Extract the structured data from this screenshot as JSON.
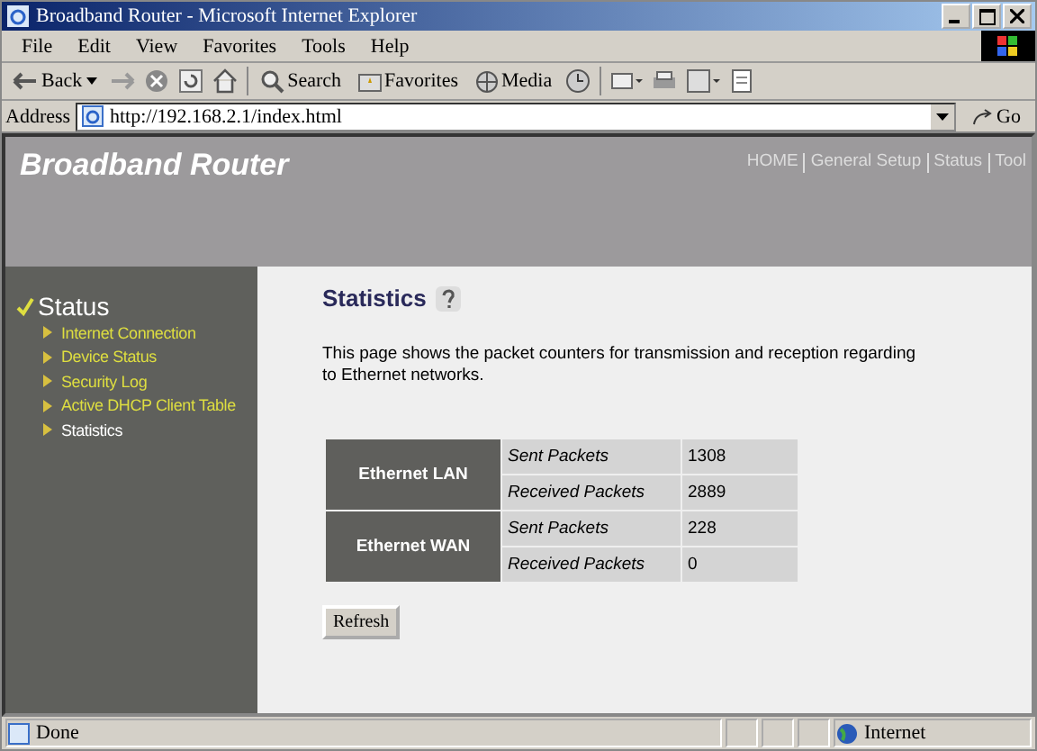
{
  "window": {
    "title": "Broadband Router - Microsoft Internet Explorer"
  },
  "menu": [
    "File",
    "Edit",
    "View",
    "Favorites",
    "Tools",
    "Help"
  ],
  "toolbar": {
    "back": "Back",
    "search": "Search",
    "favorites": "Favorites",
    "media": "Media"
  },
  "address": {
    "label": "Address",
    "value": "http://192.168.2.1/index.html",
    "go": "Go"
  },
  "header": {
    "brand": "Broadband Router",
    "nav": [
      "HOME",
      "General Setup",
      "Status",
      "Tool"
    ]
  },
  "sidebar": {
    "section": "Status",
    "items": [
      {
        "label": "Internet Connection",
        "selected": false
      },
      {
        "label": "Device Status",
        "selected": false
      },
      {
        "label": "Security Log",
        "selected": false
      },
      {
        "label": "Active DHCP Client Table",
        "selected": false
      },
      {
        "label": "Statistics",
        "selected": true
      }
    ]
  },
  "page": {
    "title": "Statistics",
    "description": "This page shows the packet counters for transmission and reception regarding to Ethernet networks.",
    "groups": [
      {
        "name": "Ethernet LAN",
        "rows": [
          {
            "label": "Sent Packets",
            "value": "1308"
          },
          {
            "label": "Received Packets",
            "value": "2889"
          }
        ]
      },
      {
        "name": "Ethernet WAN",
        "rows": [
          {
            "label": "Sent Packets",
            "value": "228"
          },
          {
            "label": "Received Packets",
            "value": "0"
          }
        ]
      }
    ],
    "button": "Refresh"
  },
  "status_bar": {
    "text": "Done",
    "zone": "Internet"
  }
}
